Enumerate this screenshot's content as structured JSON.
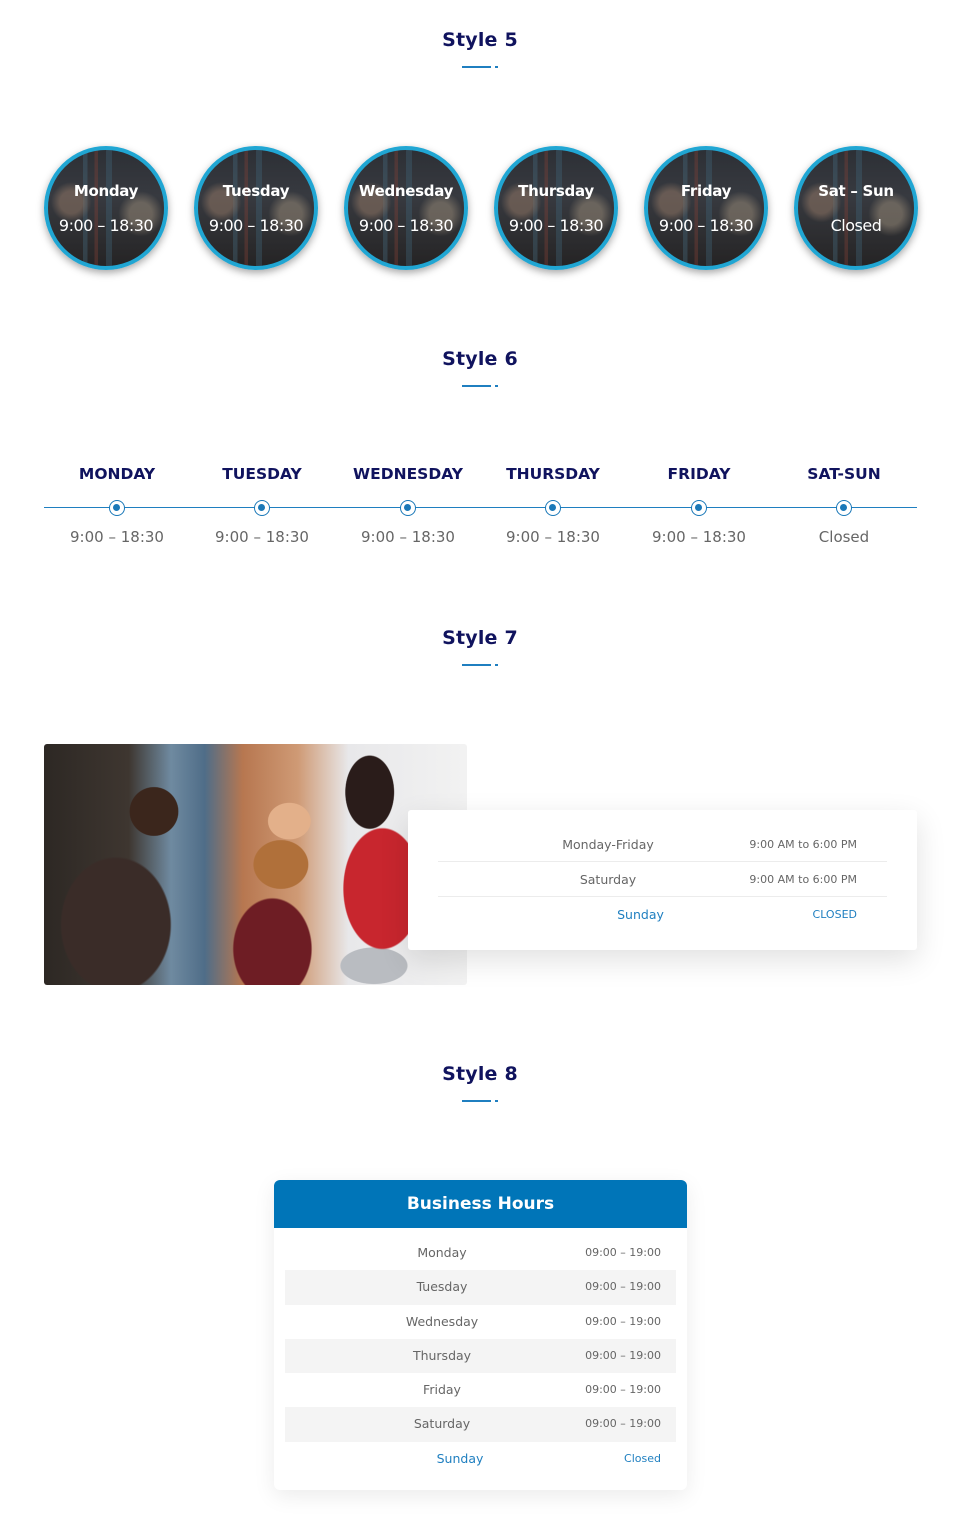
{
  "style5": {
    "title": "Style 5",
    "items": [
      {
        "day": "Monday",
        "hours": "9:00 – 18:30"
      },
      {
        "day": "Tuesday",
        "hours": "9:00 – 18:30"
      },
      {
        "day": "Wednesday",
        "hours": "9:00 – 18:30"
      },
      {
        "day": "Thursday",
        "hours": "9:00 – 18:30"
      },
      {
        "day": "Friday",
        "hours": "9:00 – 18:30"
      },
      {
        "day": "Sat – Sun",
        "hours": "Closed"
      }
    ]
  },
  "style6": {
    "title": "Style 6",
    "items": [
      {
        "day": "MONDAY",
        "hours": "9:00 – 18:30"
      },
      {
        "day": "TUESDAY",
        "hours": "9:00 – 18:30"
      },
      {
        "day": "WEDNESDAY",
        "hours": "9:00 – 18:30"
      },
      {
        "day": "THURSDAY",
        "hours": "9:00 – 18:30"
      },
      {
        "day": "FRIDAY",
        "hours": "9:00 – 18:30"
      },
      {
        "day": "SAT-SUN",
        "hours": "Closed"
      }
    ]
  },
  "style7": {
    "title": "Style 7",
    "image_alt": "team-photo",
    "rows": [
      {
        "day": "Monday-Friday",
        "hours": "9:00 AM to 6:00 PM"
      },
      {
        "day": "Saturday",
        "hours": "9:00 AM to 6:00 PM"
      },
      {
        "day": "Sunday",
        "hours": "CLOSED"
      }
    ]
  },
  "style8": {
    "title": "Style 8",
    "card_title": "Business Hours",
    "rows": [
      {
        "day": "Monday",
        "hours": "09:00 – 19:00"
      },
      {
        "day": "Tuesday",
        "hours": "09:00 – 19:00"
      },
      {
        "day": "Wednesday",
        "hours": "09:00 – 19:00"
      },
      {
        "day": "Thursday",
        "hours": "09:00 – 19:00"
      },
      {
        "day": "Friday",
        "hours": "09:00 – 19:00"
      },
      {
        "day": "Saturday",
        "hours": "09:00 – 19:00"
      },
      {
        "day": "Sunday",
        "hours": "Closed"
      }
    ]
  },
  "colors": {
    "title": "#10135e",
    "accent": "#1f7fc0",
    "header_blue": "#0075b8",
    "circle_border": "#20a6d3"
  }
}
